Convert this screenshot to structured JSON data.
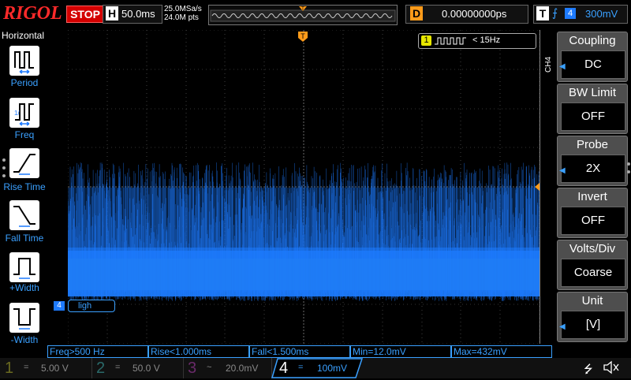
{
  "brand": "RIGOL",
  "run_state": "STOP",
  "horizontal": {
    "label": "H",
    "timebase": "50.0ms",
    "sample_rate": "25.0MSa/s",
    "memory_depth": "24.0M pts"
  },
  "delay": {
    "label": "D",
    "value": "0.00000000ps"
  },
  "trigger": {
    "label": "T",
    "source": "4",
    "level": "300mV"
  },
  "left_menu": {
    "title": "Horizontal",
    "items": [
      {
        "label": "Period"
      },
      {
        "label": "Freq"
      },
      {
        "label": "Rise Time"
      },
      {
        "label": "Fall Time"
      },
      {
        "label": "+Width"
      },
      {
        "label": "-Width"
      }
    ]
  },
  "right_menu": {
    "channel_tag": "CH4",
    "items": [
      {
        "title": "Coupling",
        "value": "DC"
      },
      {
        "title": "BW Limit",
        "value": "OFF"
      },
      {
        "title": "Probe",
        "value": "2X"
      },
      {
        "title": "Invert",
        "value": "OFF"
      },
      {
        "title": "Volts/Div",
        "value": "Coarse"
      },
      {
        "title": "Unit",
        "value": "[V]"
      }
    ]
  },
  "freq_counter": {
    "channel": "1",
    "value": "< 15Hz"
  },
  "channel4_label": {
    "marker": "4",
    "text": "ligh"
  },
  "measurements": [
    {
      "text": "Freq>500 Hz"
    },
    {
      "text": "Rise<1.000ms"
    },
    {
      "text": "Fall<1.500ms"
    },
    {
      "text": "Min=12.0mV"
    },
    {
      "text": "Max=432mV"
    }
  ],
  "channels": [
    {
      "num": "1",
      "coupling": "=",
      "scale": "5.00 V",
      "color": "#e8e800",
      "active": false
    },
    {
      "num": "2",
      "coupling": "=",
      "scale": "50.0 V",
      "color": "#00d0d0",
      "active": false
    },
    {
      "num": "3",
      "coupling": "~",
      "scale": "20.0mV",
      "color": "#d000d0",
      "active": false
    },
    {
      "num": "4",
      "coupling": "=",
      "scale": "100mV",
      "color": "#3aa0ff",
      "active": true
    }
  ],
  "colors": {
    "ch4_trace": "#1e7bff",
    "trigger_marker": "#ff9b1a",
    "grid": "#6a6a6a"
  }
}
